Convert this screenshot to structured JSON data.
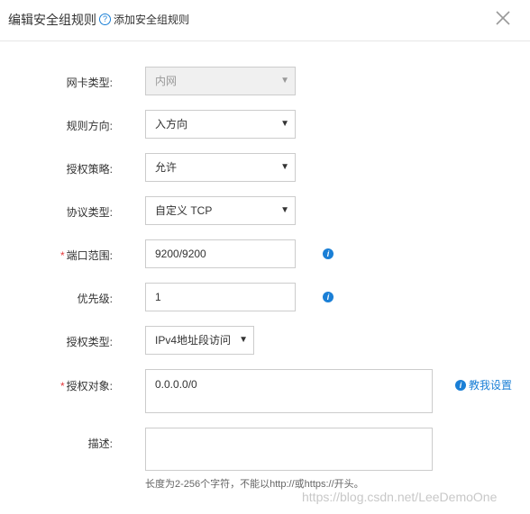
{
  "header": {
    "title": "编辑安全组规则",
    "help_icon": "question-circle",
    "help_text": "添加安全组规则",
    "close_icon": "close-x"
  },
  "form": {
    "nic_type": {
      "label": "网卡类型:",
      "value": "内网",
      "disabled": true
    },
    "direction": {
      "label": "规则方向:",
      "value": "入方向"
    },
    "policy": {
      "label": "授权策略:",
      "value": "允许"
    },
    "protocol": {
      "label": "协议类型:",
      "value": "自定义 TCP"
    },
    "port_range": {
      "required_mark": "*",
      "label": "端口范围:",
      "value": "9200/9200"
    },
    "priority": {
      "label": "优先级:",
      "value": "1"
    },
    "auth_type": {
      "label": "授权类型:",
      "value": "IPv4地址段访问"
    },
    "auth_object": {
      "required_mark": "*",
      "label": "授权对象:",
      "value": "0.0.0.0/0",
      "help_link": "教我设置"
    },
    "description": {
      "label": "描述:",
      "value": "",
      "hint": "长度为2-256个字符，不能以http://或https://开头。"
    }
  },
  "watermark": "https://blog.csdn.net/LeeDemoOne",
  "colors": {
    "accent": "#1a7fd6",
    "required": "#e4393c",
    "border": "#cccccc",
    "disabled_bg": "#f0f0f0"
  }
}
